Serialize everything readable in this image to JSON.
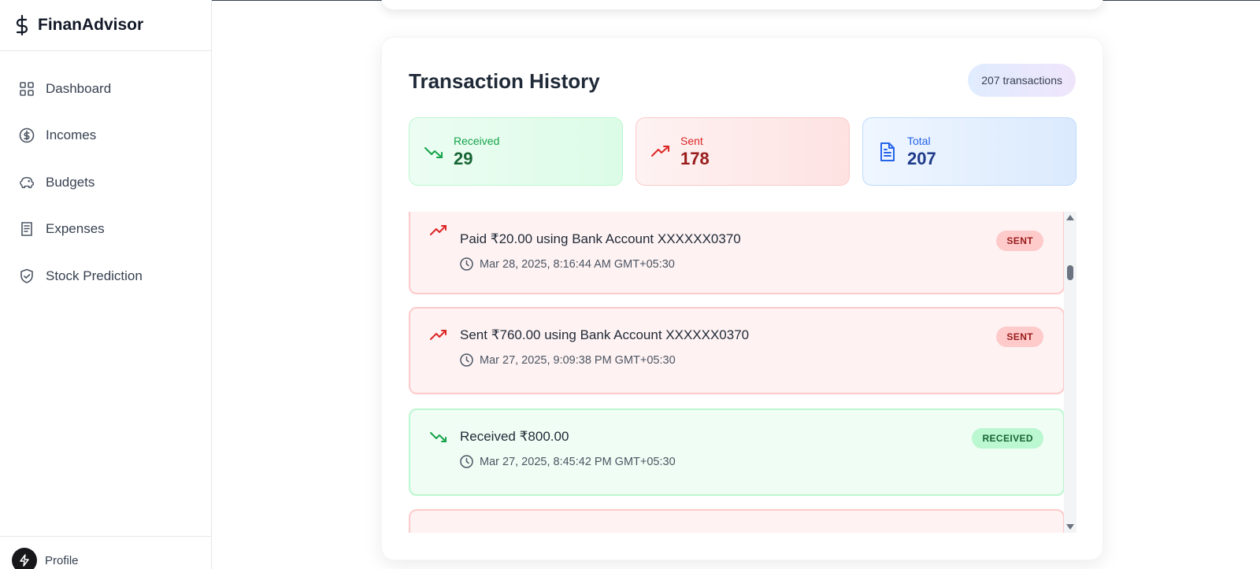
{
  "app": {
    "name": "FinanAdvisor"
  },
  "sidebar": {
    "items": [
      {
        "label": "Dashboard",
        "icon": "grid-icon"
      },
      {
        "label": "Incomes",
        "icon": "dollar-circle-icon"
      },
      {
        "label": "Budgets",
        "icon": "piggy-bank-icon"
      },
      {
        "label": "Expenses",
        "icon": "receipt-icon"
      },
      {
        "label": "Stock Prediction",
        "icon": "shield-check-icon"
      }
    ],
    "profile": {
      "label": "Profile"
    }
  },
  "history": {
    "title": "Transaction History",
    "count_label": "207 transactions",
    "stats": {
      "received": {
        "label": "Received",
        "value": "29"
      },
      "sent": {
        "label": "Sent",
        "value": "178"
      },
      "total": {
        "label": "Total",
        "value": "207"
      }
    },
    "transactions": [
      {
        "description": "Paid ₹20.00 using Bank Account XXXXXX0370",
        "time": "Mar 28, 2025, 8:16:44 AM GMT+05:30",
        "badge": "SENT",
        "type": "sent"
      },
      {
        "description": "Sent ₹760.00 using Bank Account XXXXXX0370",
        "time": "Mar 27, 2025, 9:09:38 PM GMT+05:30",
        "badge": "SENT",
        "type": "sent"
      },
      {
        "description": "Received ₹800.00",
        "time": "Mar 27, 2025, 8:45:42 PM GMT+05:30",
        "badge": "RECEIVED",
        "type": "received"
      }
    ]
  },
  "colors": {
    "sent_accent": "#dc2626",
    "received_accent": "#16a34a",
    "total_accent": "#2563eb"
  }
}
